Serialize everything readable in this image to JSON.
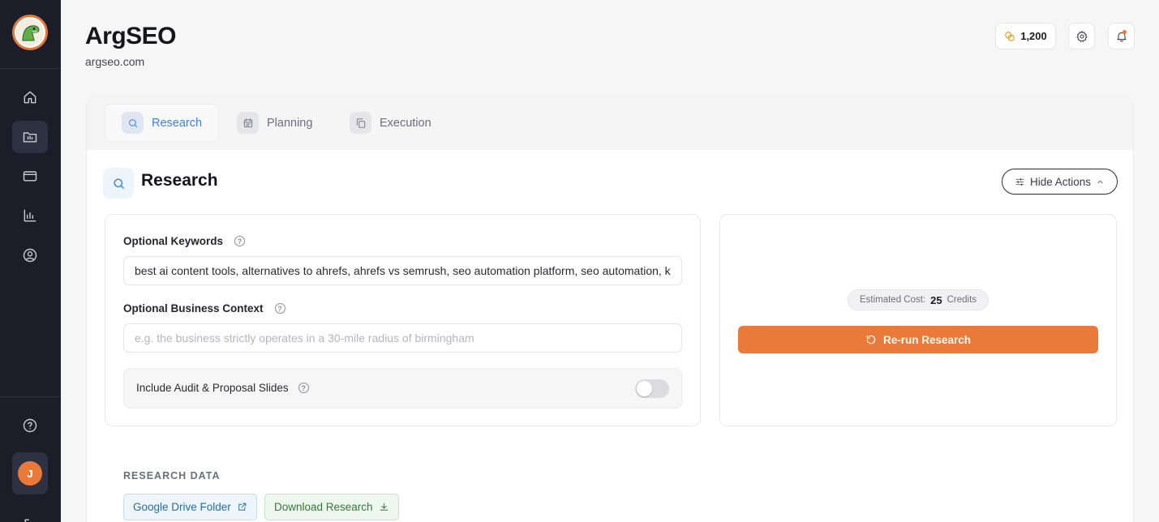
{
  "app": {
    "title": "ArgSEO",
    "domain": "argseo.com"
  },
  "header": {
    "credits": "1,200"
  },
  "sidebar": {
    "items": [
      {
        "name": "home-icon"
      },
      {
        "name": "projects-icon",
        "active": true
      },
      {
        "name": "billing-icon"
      },
      {
        "name": "analytics-icon"
      },
      {
        "name": "account-icon"
      }
    ],
    "avatar_initial": "J"
  },
  "tabs": [
    {
      "label": "Research",
      "active": true,
      "icon": "search-icon"
    },
    {
      "label": "Planning",
      "icon": "calendar-icon"
    },
    {
      "label": "Execution",
      "icon": "copy-icon"
    }
  ],
  "section": {
    "title": "Research",
    "hide_actions_label": "Hide Actions"
  },
  "form": {
    "keywords_label": "Optional Keywords",
    "keywords_value": "best ai content tools, alternatives to ahrefs, ahrefs vs semrush, seo automation platform, seo automation, k",
    "context_label": "Optional Business Context",
    "context_placeholder": "e.g. the business strictly operates in a 30-mile radius of birmingham",
    "context_value": "",
    "toggle_label": "Include Audit & Proposal Slides",
    "toggle_on": false
  },
  "actions": {
    "cost_label": "Estimated Cost:",
    "cost_value": "25",
    "cost_unit": "Credits",
    "rerun_label": "Re-run Research"
  },
  "research_data": {
    "heading": "RESEARCH DATA",
    "drive_label": "Google Drive Folder",
    "download_label": "Download Research"
  },
  "colors": {
    "accent": "#ea7a3a",
    "primary_blue": "#3b82e0",
    "sidebar_bg": "#1b1d29"
  }
}
